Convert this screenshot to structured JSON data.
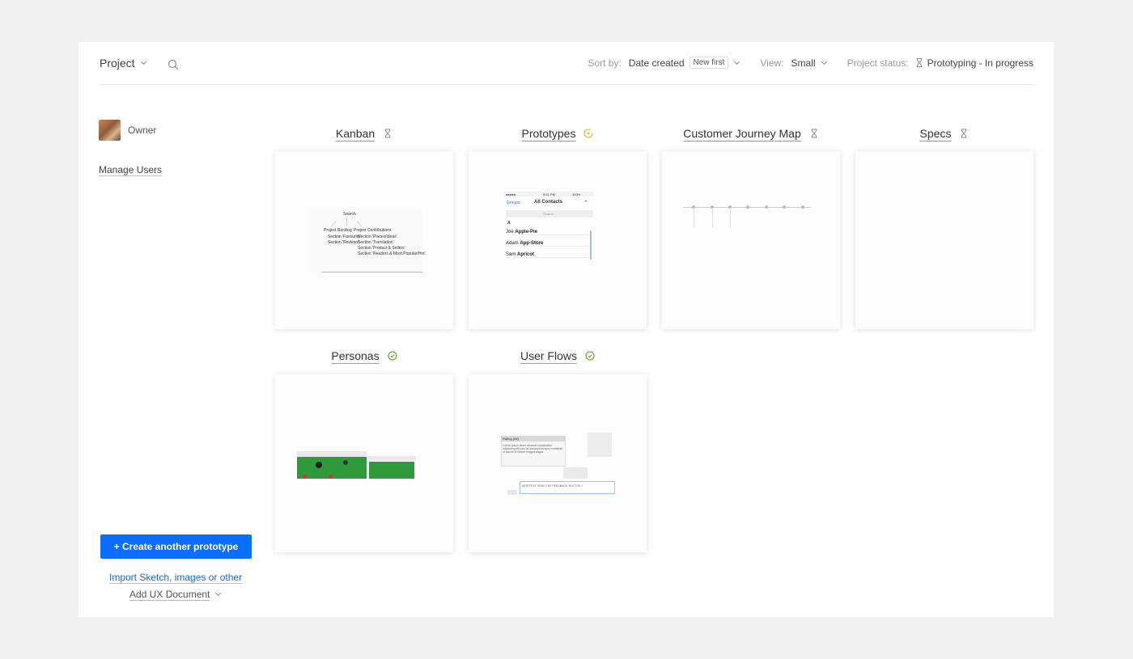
{
  "header": {
    "project_label": "Project",
    "sort_label": "Sort by:",
    "sort_value": "Date created",
    "sort_badge": "New first",
    "view_label": "View:",
    "view_value": "Small",
    "status_label": "Project status:",
    "status_value": "Prototyping - In progress"
  },
  "sidebar": {
    "owner_label": "Owner",
    "manage_users": "Manage Users",
    "create_button": "+ Create another prototype",
    "import_link": "Import Sketch, images or other",
    "add_ux": "Add UX Document"
  },
  "cards": [
    {
      "title": "Kanban",
      "status": "hourglass"
    },
    {
      "title": "Prototypes",
      "status": "in-review"
    },
    {
      "title": "Customer Journey Map",
      "status": "hourglass"
    },
    {
      "title": "Specs",
      "status": "hourglass"
    },
    {
      "title": "Personas",
      "status": "approved"
    },
    {
      "title": "User Flows",
      "status": "approved"
    }
  ],
  "thumbnails": {
    "kanban": {
      "root": "Search",
      "left_group": "Project Backlog",
      "left_items": [
        "Section 'Favourite'",
        "Section 'Reviews'"
      ],
      "right_group": "Project Contributions",
      "right_items": [
        "Section 'Places/Ideas'",
        "Section 'Translation'",
        "Section 'Product & Sellers'",
        "Section 'Readers & Most Popular/Hot'"
      ]
    },
    "prototypes": {
      "status_left": "●●●●●",
      "status_time": "9:41 PM",
      "status_right": "100%",
      "nav_left": "Groups",
      "nav_title": "All Contacts",
      "nav_add": "+",
      "search_placeholder": "Search",
      "section": "A",
      "rows": [
        {
          "first": "Joe",
          "last": "Apple-Pie"
        },
        {
          "first": "Adam",
          "last": "App-Store"
        },
        {
          "first": "Sam",
          "last": "Apricot"
        }
      ]
    },
    "user_flows": {
      "box_title": "Rating (All)",
      "box_text": "Lorem ipsum dolor sit amet consectetur adipiscing elit sed do eiusmod tempor incididunt ut labore et dolore magna aliqua",
      "input_text": "WHERE IS 'SEND THE FEEDBACK' BUTTON ?"
    }
  },
  "colors": {
    "accent": "#0c6efd",
    "link": "#1467d8",
    "in_review": "#f5a623",
    "approved": "#5aa01e",
    "neutral_icon": "#888888"
  }
}
